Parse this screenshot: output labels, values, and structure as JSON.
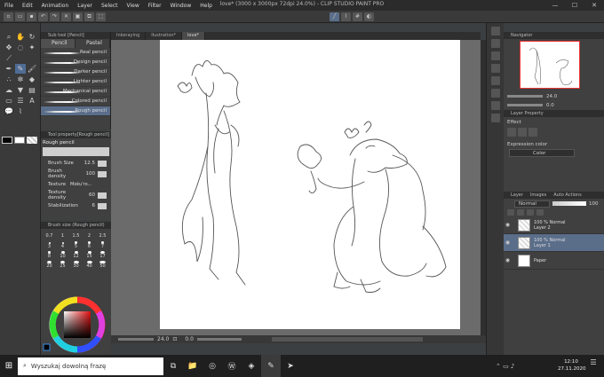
{
  "menu": [
    "File",
    "Edit",
    "Animation",
    "Layer",
    "Select",
    "View",
    "Filter",
    "Window",
    "Help"
  ],
  "window_title": "love* (3000 x 3000px 72dpi 24.0%)  - CLIP STUDIO PAINT PRO",
  "subtool": {
    "panel_title": "Sub tool [Pencil]",
    "tabs": [
      "Pencil",
      "Pastel"
    ],
    "brushes": [
      "Real pencil",
      "Design pencil",
      "Darker pencil",
      "Lighter pencil",
      "Mechanical pencil",
      "Colored pencil",
      "Rough pencil"
    ]
  },
  "tool_property": {
    "panel_title": "Tool property[Rough pencil]",
    "name": "Rough pencil",
    "rows": [
      {
        "label": "Brush Size",
        "value": "12.5"
      },
      {
        "label": "Brush density",
        "value": "100"
      },
      {
        "label": "Texture",
        "value": "Moku'ro..."
      },
      {
        "label": "Texture density",
        "value": "60"
      },
      {
        "label": "Stabilization",
        "value": "6"
      }
    ]
  },
  "brush_size": {
    "panel_title": "Brush size (Rough pencil)",
    "sizes": [
      "0.7",
      "1",
      "1.5",
      "2",
      "2.5",
      "3",
      "4",
      "5",
      "6",
      "7",
      "8",
      "10",
      "12",
      "15",
      "17",
      "20",
      "25",
      "30",
      "40",
      "50"
    ]
  },
  "doc_tabs": [
    "Inkeraying",
    "Ilustration*",
    "love*"
  ],
  "status": {
    "zoom": "24.0",
    "angle": "0.0"
  },
  "navigator": {
    "title": "Navigator",
    "zoom": "24.0",
    "angle": "0.0"
  },
  "layer_property": {
    "title": "Layer Property",
    "effect_label": "Effect",
    "expression_label": "Expression color",
    "expression_value": "Color"
  },
  "layer_panel": {
    "tabs": [
      "Layer",
      "Images",
      "Auto Actions"
    ],
    "blend_mode": "Normal",
    "opacity": "100",
    "layers": [
      {
        "percent": "100 % Normal",
        "name": "Layer 2"
      },
      {
        "percent": "100 % Normal",
        "name": "Layer 1"
      },
      {
        "percent": "",
        "name": "Paper"
      }
    ]
  },
  "taskbar": {
    "search_placeholder": "Wyszukaj dowolną frazę",
    "time": "12:10",
    "date": "27.11.2020"
  },
  "colors": {
    "accent": "#5a6e8a",
    "panel": "#404040",
    "canvas_bg": "#6b6b6b"
  }
}
